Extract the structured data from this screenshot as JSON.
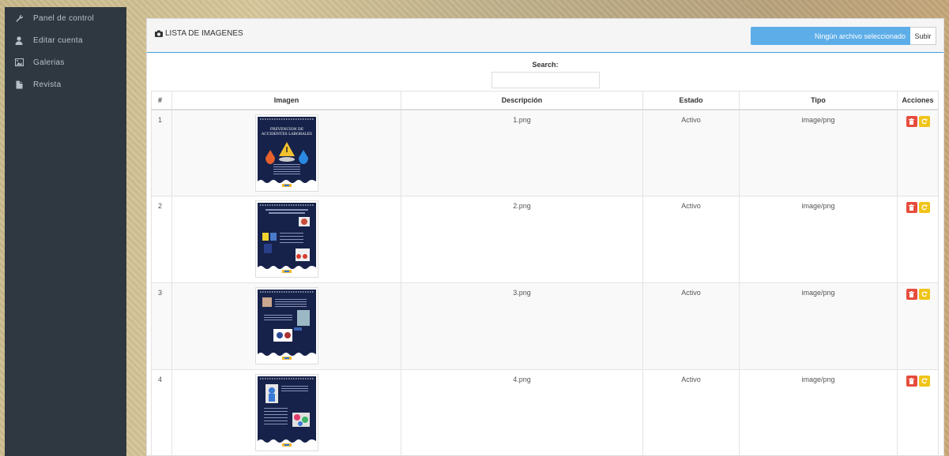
{
  "sidebar": {
    "items": [
      {
        "label": "Panel de control",
        "icon": "wrench-icon"
      },
      {
        "label": "Editar cuenta",
        "icon": "user-icon"
      },
      {
        "label": "Galerias",
        "icon": "picture-icon"
      },
      {
        "label": "Revista",
        "icon": "file-icon"
      }
    ]
  },
  "panel": {
    "title": "LISTA DE IMAGENES",
    "file_status": "Ningún archivo seleccionado",
    "upload_label": "Subir"
  },
  "search": {
    "label": "Search:",
    "value": ""
  },
  "table": {
    "headers": [
      "#",
      "Imagen",
      "Descripción",
      "Estado",
      "Tipo",
      "Acciones"
    ],
    "rows": [
      {
        "num": "1",
        "description": "1.png",
        "status": "Activo",
        "type": "image/png",
        "thumb_title": "PREVENCION DE ACCIDENTES LABORALES"
      },
      {
        "num": "2",
        "description": "2.png",
        "status": "Activo",
        "type": "image/png",
        "thumb_title": ""
      },
      {
        "num": "3",
        "description": "3.png",
        "status": "Activo",
        "type": "image/png",
        "thumb_title": ""
      },
      {
        "num": "4",
        "description": "4.png",
        "status": "Activo",
        "type": "image/png",
        "thumb_title": ""
      }
    ]
  },
  "colors": {
    "sidebar_bg": "#2f3840",
    "accent_blue": "#5dade8",
    "delete_red": "#e74c3c",
    "refresh_yellow": "#f0c419",
    "thumb_navy": "#16224a"
  }
}
